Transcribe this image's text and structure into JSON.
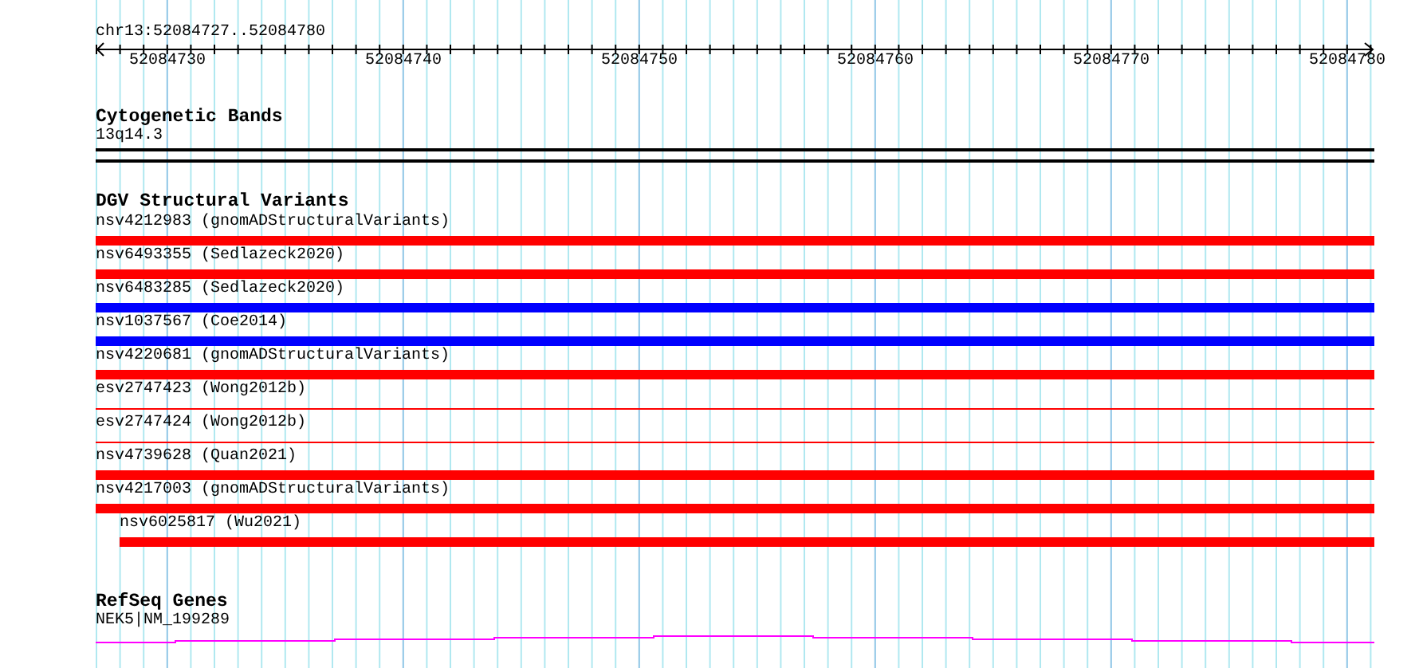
{
  "location": "chr13:52084727..52084780",
  "ruler": {
    "labels": [
      "52084730",
      "52084740",
      "52084750",
      "52084760",
      "52084770",
      "52084780"
    ]
  },
  "cytogenetic_bands": {
    "title": "Cytogenetic Bands",
    "band": "13q14.3"
  },
  "dgv": {
    "title": "DGV Structural Variants",
    "variants": [
      {
        "label": "nsv4212983 (gnomADStructuralVariants)",
        "color": "#ff0000",
        "kind": "thick",
        "partial": false
      },
      {
        "label": "nsv6493355 (Sedlazeck2020)",
        "color": "#ff0000",
        "kind": "thick",
        "partial": false
      },
      {
        "label": "nsv6483285 (Sedlazeck2020)",
        "color": "#0000ff",
        "kind": "thick",
        "partial": false
      },
      {
        "label": "nsv1037567 (Coe2014)",
        "color": "#0000ff",
        "kind": "thick",
        "partial": false
      },
      {
        "label": "nsv4220681 (gnomADStructuralVariants)",
        "color": "#ff0000",
        "kind": "thick",
        "partial": false
      },
      {
        "label": "esv2747423 (Wong2012b)",
        "color": "#ff0000",
        "kind": "thin",
        "partial": false
      },
      {
        "label": "esv2747424 (Wong2012b)",
        "color": "#ff0000",
        "kind": "thin",
        "partial": false
      },
      {
        "label": "nsv4739628 (Quan2021)",
        "color": "#ff0000",
        "kind": "thick",
        "partial": false
      },
      {
        "label": "nsv4217003 (gnomADStructuralVariants)",
        "color": "#ff0000",
        "kind": "thick",
        "partial": false
      },
      {
        "label": "nsv6025817 (Wu2021)",
        "color": "#ff0000",
        "kind": "thick",
        "partial": true
      }
    ]
  },
  "refseq": {
    "title": "RefSeq Genes",
    "gene": "NEK5|NM_199289"
  }
}
